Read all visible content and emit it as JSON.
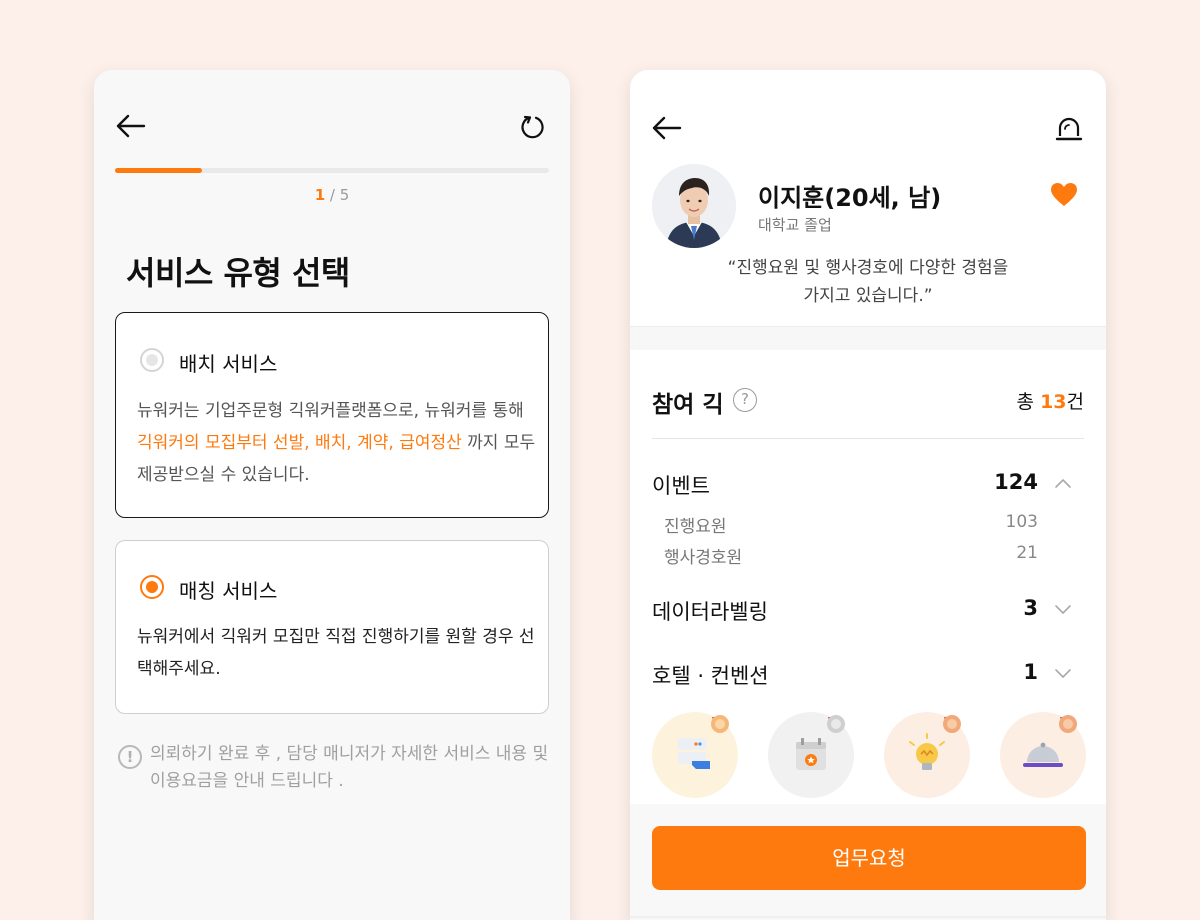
{
  "left": {
    "progress": {
      "current": "1",
      "separator": " / ",
      "total": "5",
      "fraction": 0.2
    },
    "title": "서비스 유형 선택",
    "options": [
      {
        "title": "배치 서비스",
        "selected": false,
        "desc_before": "뉴워커는 기업주문형 긱워커플랫폼으로, 뉴워커를 통해 ",
        "desc_highlight": "긱워커의 모집부터 선발, 배치, 계약, 급여정산",
        "desc_after": " 까지 모두 제공받으실 수 있습니다."
      },
      {
        "title": "매칭 서비스",
        "selected": true,
        "desc": "뉴워커에서 긱워커 모집만 직접 진행하기를 원할 경우 선택해주세요."
      }
    ],
    "notice": "의뢰하기  완료 후 , 담당 매니저가 자세한 서비스 내용 및 이용요금을 안내 드립니다 ."
  },
  "right": {
    "profile": {
      "name": "이지훈(20세, 남)",
      "education": "대학교 졸업",
      "quote_line1": "“진행요원 및 행사경호에 다양한 경험을",
      "quote_line2": "가지고 있습니다.”"
    },
    "gigs": {
      "title": "참여 긱",
      "help": "?",
      "total_prefix": "총 ",
      "total_count": "13",
      "total_suffix": "건",
      "categories": [
        {
          "label": "이벤트",
          "count": "124",
          "expanded": true,
          "subs": [
            {
              "label": "진행요원",
              "count": "103"
            },
            {
              "label": "행사경호원",
              "count": "21"
            }
          ]
        },
        {
          "label": "데이터라벨링",
          "count": "3",
          "expanded": false
        },
        {
          "label": "호텔 · 컨벤션",
          "count": "1",
          "expanded": false
        }
      ],
      "badges": [
        "server-badge-icon",
        "calendar-badge-icon",
        "lightbulb-badge-icon",
        "cloche-badge-icon"
      ]
    },
    "cta": "업무요청"
  },
  "colors": {
    "accent": "#ff7a0e",
    "background": "#fdf0ea"
  }
}
